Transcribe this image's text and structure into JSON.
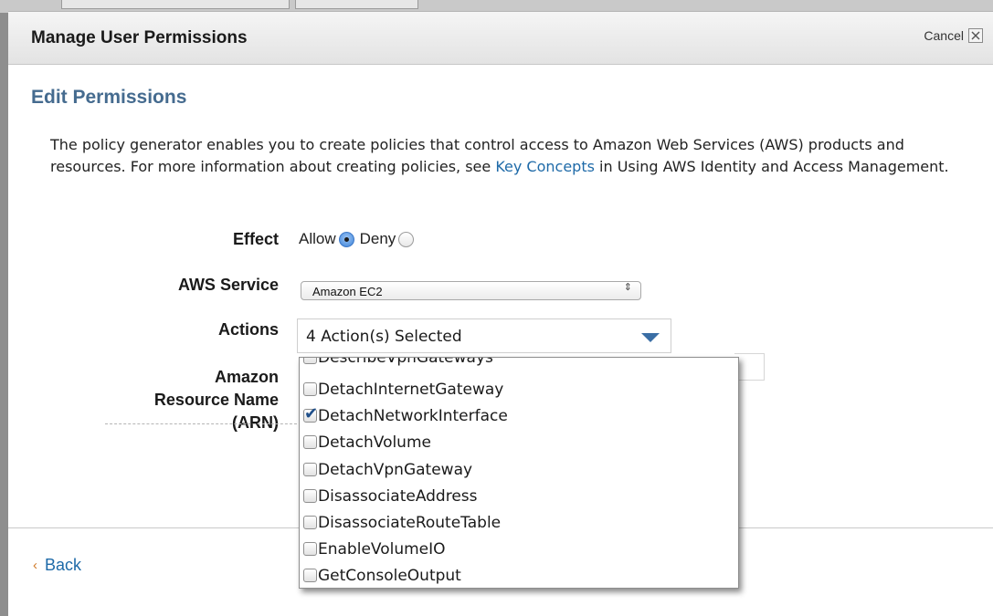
{
  "dialog": {
    "title": "Manage User Permissions",
    "cancel_label": "Cancel",
    "close_glyph": "×"
  },
  "section": {
    "title": "Edit Permissions"
  },
  "description": {
    "before_link": "The policy generator enables you to create policies that control access to Amazon Web Services (AWS) products and resources. For more information about creating policies, see ",
    "link_text": "Key Concepts",
    "after_link": " in Using AWS Identity and Access Management."
  },
  "form": {
    "effect": {
      "label": "Effect",
      "options": [
        {
          "label": "Allow",
          "selected": true
        },
        {
          "label": "Deny",
          "selected": false
        }
      ]
    },
    "aws_service": {
      "label": "AWS Service",
      "value": "Amazon EC2",
      "arrow_glyph": "⇕"
    },
    "actions": {
      "label": "Actions",
      "value": "4 Action(s) Selected",
      "options": [
        {
          "label": "DescribeVpnGateways",
          "checked": false
        },
        {
          "label": "DetachInternetGateway",
          "checked": false
        },
        {
          "label": "DetachNetworkInterface",
          "checked": true
        },
        {
          "label": "DetachVolume",
          "checked": false
        },
        {
          "label": "DetachVpnGateway",
          "checked": false
        },
        {
          "label": "DisassociateAddress",
          "checked": false
        },
        {
          "label": "DisassociateRouteTable",
          "checked": false
        },
        {
          "label": "EnableVolumeIO",
          "checked": false
        },
        {
          "label": "GetConsoleOutput",
          "checked": false
        }
      ]
    },
    "arn": {
      "label_line1": "Amazon",
      "label_line2": "Resource Name",
      "label_line3": "(ARN)"
    }
  },
  "footer": {
    "back_chevron": "‹",
    "back_label": "Back"
  },
  "colors": {
    "section_title": "#456b8f",
    "link": "#1e6aa8",
    "back_chevron": "#d07a28",
    "dropdown_caret": "#3a6ea5"
  }
}
